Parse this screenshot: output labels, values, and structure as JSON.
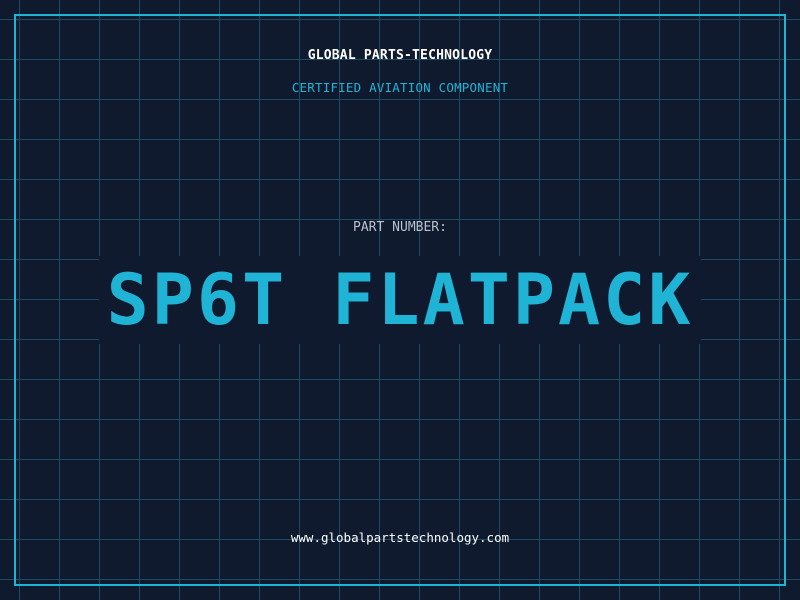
{
  "header": {
    "brand": "GLOBAL PARTS-TECHNOLOGY",
    "tagline": "CERTIFIED AVIATION COMPONENT"
  },
  "part": {
    "label": "PART NUMBER:",
    "value": "SP6T FLATPACK"
  },
  "footer": {
    "url": "www.globalpartstechnology.com"
  },
  "colors": {
    "background": "#101a2e",
    "grid": "#1b4b63",
    "accent": "#1fb3d6",
    "text": "#ffffff",
    "muted": "#b9c1cc"
  }
}
